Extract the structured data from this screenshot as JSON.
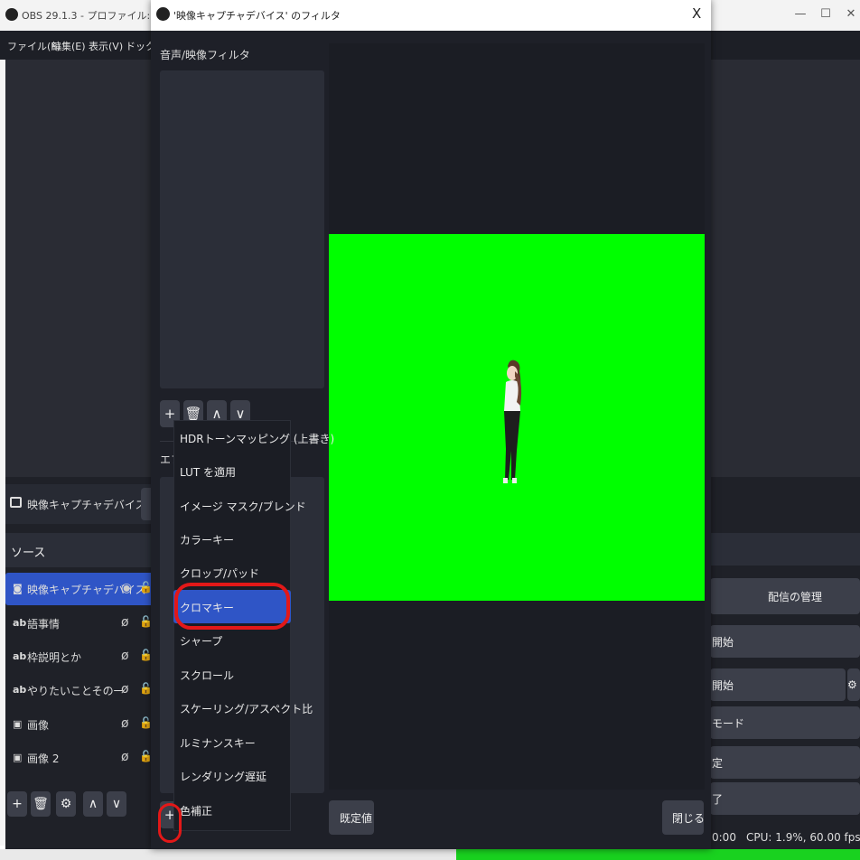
{
  "main_window": {
    "title": "OBS 29.1.3 - プロファイル: 無題 - シーン: 無",
    "window_controls": {
      "minimize": "—",
      "maximize": "☐",
      "close": "✕"
    },
    "menu": [
      "ファイル(F)",
      "編集(E)",
      "表示(V)",
      "ドック(D"
    ],
    "current_source": "映像キャプチャデバイス",
    "sources_header": "ソース",
    "sources": [
      {
        "icon": "camera-icon",
        "glyph": "◙",
        "label": "映像キャプチャデバイス",
        "selected": true
      },
      {
        "icon": "text-icon",
        "glyph": "ab",
        "label": "語事情",
        "selected": false
      },
      {
        "icon": "text-icon",
        "glyph": "ab",
        "label": "枠説明とか",
        "selected": false
      },
      {
        "icon": "text-icon",
        "glyph": "ab",
        "label": "やりたいことその一",
        "selected": false
      },
      {
        "icon": "image-icon",
        "glyph": "▣",
        "label": "画像",
        "selected": false
      },
      {
        "icon": "image-icon",
        "glyph": "▣",
        "label": "画像 2",
        "selected": false
      }
    ],
    "sources_toolbar": {
      "add": "+",
      "remove": "🗑",
      "settings": "⚙",
      "up": "∧",
      "down": "∨"
    },
    "controls": {
      "stream_management": "配信の管理",
      "start_streaming": "開始",
      "start_recording": "開始",
      "studio_mode": "モード",
      "settings": "定",
      "exit": "了"
    },
    "status": {
      "time": "0:00",
      "cpu": "CPU: 1.9%, 60.00 fps"
    }
  },
  "filter_dialog": {
    "title": "'映像キャプチャデバイス' のフィルタ",
    "close_glyph": "X",
    "audio_video_filters_label": "音声/映像フィルタ",
    "effect_filters_label": "エフ",
    "toolbar": {
      "add": "+",
      "remove": "🗑",
      "up": "∧",
      "down": "∨"
    },
    "defaults_button": "既定値",
    "close_button": "閉じる",
    "preview_background_color": "#00ff00"
  },
  "filter_menu": {
    "items": [
      {
        "label": "HDRトーンマッピング (上書き)",
        "highlighted": false
      },
      {
        "label": "LUT を適用",
        "highlighted": false
      },
      {
        "label": "イメージ マスク/ブレンド",
        "highlighted": false
      },
      {
        "label": "カラーキー",
        "highlighted": false
      },
      {
        "label": "クロップ/パッド",
        "highlighted": false
      },
      {
        "label": "クロマキー",
        "highlighted": true
      },
      {
        "label": "シャープ",
        "highlighted": false
      },
      {
        "label": "スクロール",
        "highlighted": false
      },
      {
        "label": "スケーリング/アスペクト比",
        "highlighted": false
      },
      {
        "label": "ルミナンスキー",
        "highlighted": false
      },
      {
        "label": "レンダリング遅延",
        "highlighted": false
      },
      {
        "label": "色補正",
        "highlighted": false
      }
    ]
  },
  "annotation_color": "#e31818"
}
